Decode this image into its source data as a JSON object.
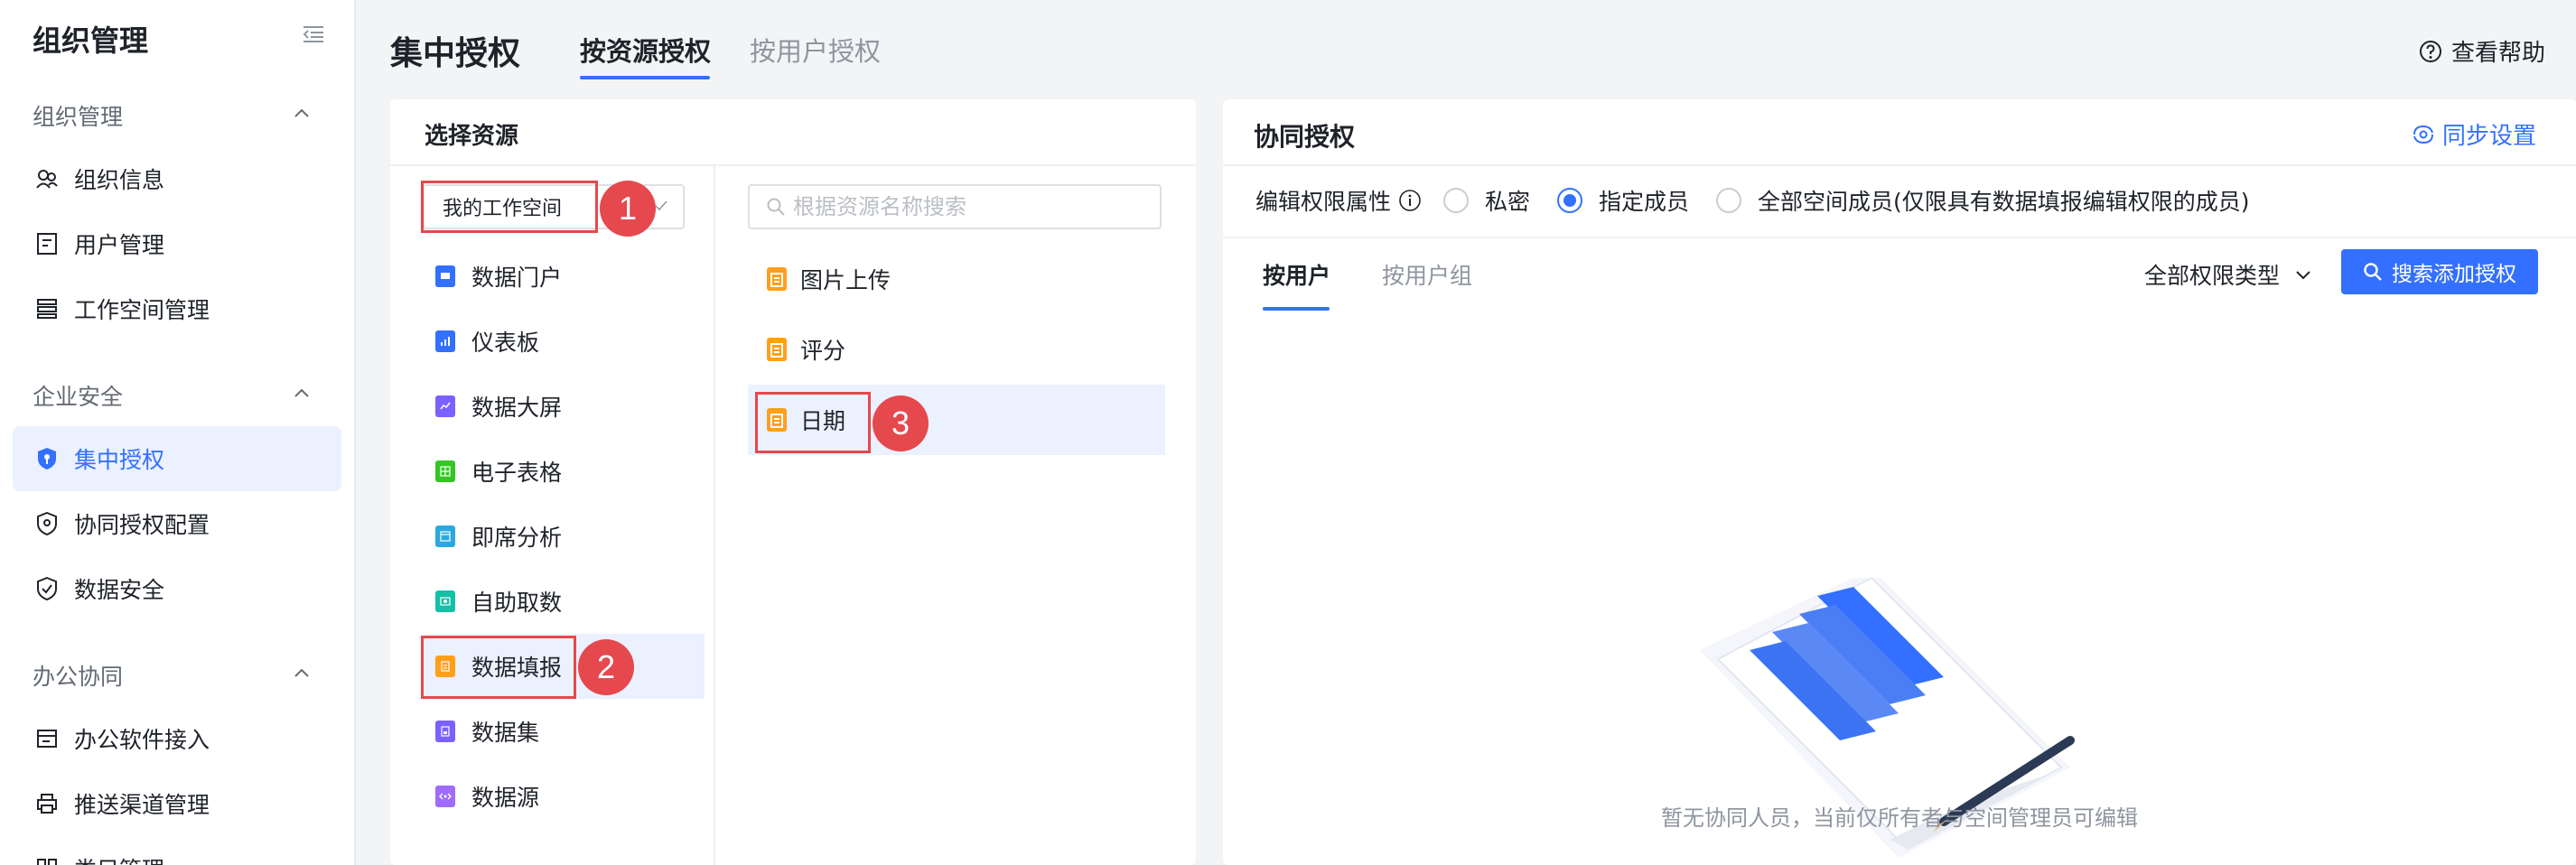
{
  "sidebar": {
    "title": "组织管理",
    "groups": [
      {
        "label": "组织管理",
        "items": [
          {
            "label": "组织信息",
            "icon": "org-info-icon"
          },
          {
            "label": "用户管理",
            "icon": "user-manage-icon"
          },
          {
            "label": "工作空间管理",
            "icon": "workspace-icon"
          }
        ]
      },
      {
        "label": "企业安全",
        "items": [
          {
            "label": "集中授权",
            "icon": "shield-icon",
            "active": true
          },
          {
            "label": "协同授权配置",
            "icon": "collab-shield-icon"
          },
          {
            "label": "数据安全",
            "icon": "data-security-icon"
          }
        ]
      },
      {
        "label": "办公协同",
        "items": [
          {
            "label": "办公软件接入",
            "icon": "office-icon"
          },
          {
            "label": "推送渠道管理",
            "icon": "printer-icon"
          },
          {
            "label": "类目管理",
            "icon": "category-icon"
          }
        ]
      }
    ]
  },
  "header": {
    "title": "集中授权",
    "tabs": [
      "按资源授权",
      "按用户授权"
    ],
    "help": "查看帮助"
  },
  "resources": {
    "title": "选择资源",
    "workspace": "我的工作空间",
    "categories": [
      {
        "label": "数据门户",
        "color": "#3370ff"
      },
      {
        "label": "仪表板",
        "color": "#3370ff"
      },
      {
        "label": "数据大屏",
        "color": "#7b61ff"
      },
      {
        "label": "电子表格",
        "color": "#34c724"
      },
      {
        "label": "即席分析",
        "color": "#2aa9e0"
      },
      {
        "label": "自助取数",
        "color": "#14c0a6"
      },
      {
        "label": "数据填报",
        "color": "#ff9f1a",
        "active": true
      },
      {
        "label": "数据集",
        "color": "#7b61ff"
      },
      {
        "label": "数据源",
        "color": "#9f6bff"
      }
    ],
    "search_placeholder": "根据资源名称搜索",
    "items": [
      {
        "label": "图片上传"
      },
      {
        "label": "评分"
      },
      {
        "label": "日期",
        "active": true
      }
    ]
  },
  "annotations": [
    "1",
    "2",
    "3"
  ],
  "collab": {
    "title": "协同授权",
    "sync": "同步设置",
    "perm_label": "编辑权限属性",
    "options": [
      "私密",
      "指定成员",
      "全部空间成员(仅限具有数据填报编辑权限的成员)"
    ],
    "selected_option": 1,
    "sub_tabs": [
      "按用户",
      "按用户组"
    ],
    "perm_type": "全部权限类型",
    "add_button": "搜索添加授权",
    "empty_text": "暂无协同人员，当前仅所有者与空间管理员可编辑"
  },
  "colors": {
    "accent": "#3370ff",
    "annotation": "#e5484d"
  }
}
